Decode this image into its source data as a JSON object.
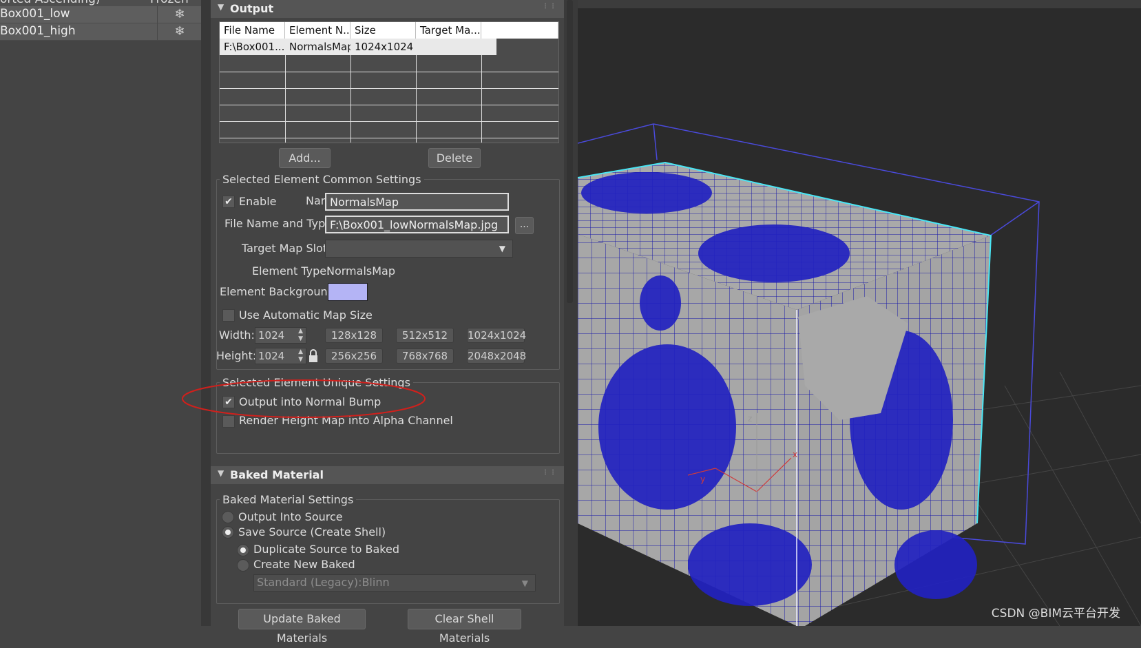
{
  "scene_list": {
    "header_left": "orted Ascending)",
    "header_right": "Frozen",
    "rows": [
      {
        "name": "Box001_low",
        "freeze_icon": "snowflake-icon"
      },
      {
        "name": "Box001_high",
        "freeze_icon": "snowflake-icon"
      }
    ]
  },
  "output": {
    "title": "Output",
    "columns": [
      "File Name",
      "Element N...",
      "Size",
      "Target Ma..."
    ],
    "rows": [
      {
        "file_name": "F:\\Box001...",
        "element_name": "NormalsMap",
        "size": "1024x1024",
        "target": ""
      }
    ],
    "add_label": "Add...",
    "delete_label": "Delete"
  },
  "common": {
    "title": "Selected Element Common Settings",
    "enable_label": "Enable",
    "enable_checked": true,
    "name_label": "Name:",
    "name_value": "NormalsMap",
    "file_label": "File Name and Type:",
    "file_value": "F:\\Box001_lowNormalsMap.jpg",
    "browse_label": "...",
    "target_label": "Target Map Slot:",
    "target_value": "",
    "type_label": "Element Type:",
    "type_value": "NormalsMap",
    "bg_label": "Element Background:",
    "bg_color": "#b4b4f5",
    "auto_size_label": "Use Automatic Map Size",
    "auto_size_checked": false,
    "width_label": "Width:",
    "width_value": "1024",
    "height_label": "Height:",
    "height_value": "1024",
    "presets": [
      "128x128",
      "512x512",
      "1024x1024",
      "256x256",
      "768x768",
      "2048x2048"
    ]
  },
  "unique": {
    "title": "Selected Element Unique Settings",
    "normal_bump_label": "Output into Normal Bump",
    "normal_bump_checked": true,
    "height_alpha_label": "Render Height Map into Alpha Channel",
    "height_alpha_checked": false
  },
  "baked": {
    "title": "Baked Material",
    "group_title": "Baked Material Settings",
    "output_source_label": "Output Into Source",
    "save_source_label": "Save Source (Create Shell)",
    "duplicate_label": "Duplicate Source to Baked",
    "create_new_label": "Create New Baked",
    "material_value": "Standard (Legacy):Blinn",
    "update_label": "Update Baked Materials",
    "clear_label": "Clear Shell Materials"
  },
  "viewport": {
    "watermark": "CSDN @BIM云平台开发",
    "axis_x": "x",
    "axis_y": "y",
    "axis_z": "z"
  }
}
